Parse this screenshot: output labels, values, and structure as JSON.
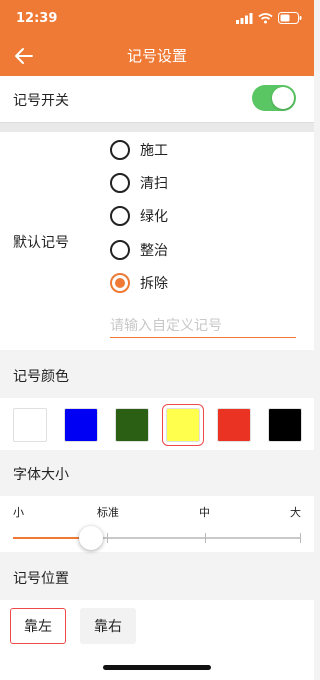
{
  "status_bar": {
    "time": "12:39"
  },
  "header": {
    "title": "记号设置"
  },
  "mark_switch": {
    "label": "记号开关",
    "on": true
  },
  "default_mark": {
    "label": "默认记号",
    "options": [
      "施工",
      "清扫",
      "绿化",
      "整治",
      "拆除"
    ],
    "selected": "拆除",
    "custom_placeholder": "请输入自定义记号"
  },
  "mark_color": {
    "label": "记号颜色",
    "swatches": [
      "#ffffff",
      "#0000f5",
      "#2b5f14",
      "#ffff4d",
      "#eb3323",
      "#000000"
    ],
    "selected_index": 3
  },
  "font_size": {
    "label": "字体大小",
    "ticks": [
      "小",
      "标准",
      "中",
      "大"
    ],
    "value": "标准",
    "accent": "#ee7a35"
  },
  "mark_position": {
    "label": "记号位置",
    "options": [
      "靠左",
      "靠右"
    ],
    "selected": "靠左"
  }
}
